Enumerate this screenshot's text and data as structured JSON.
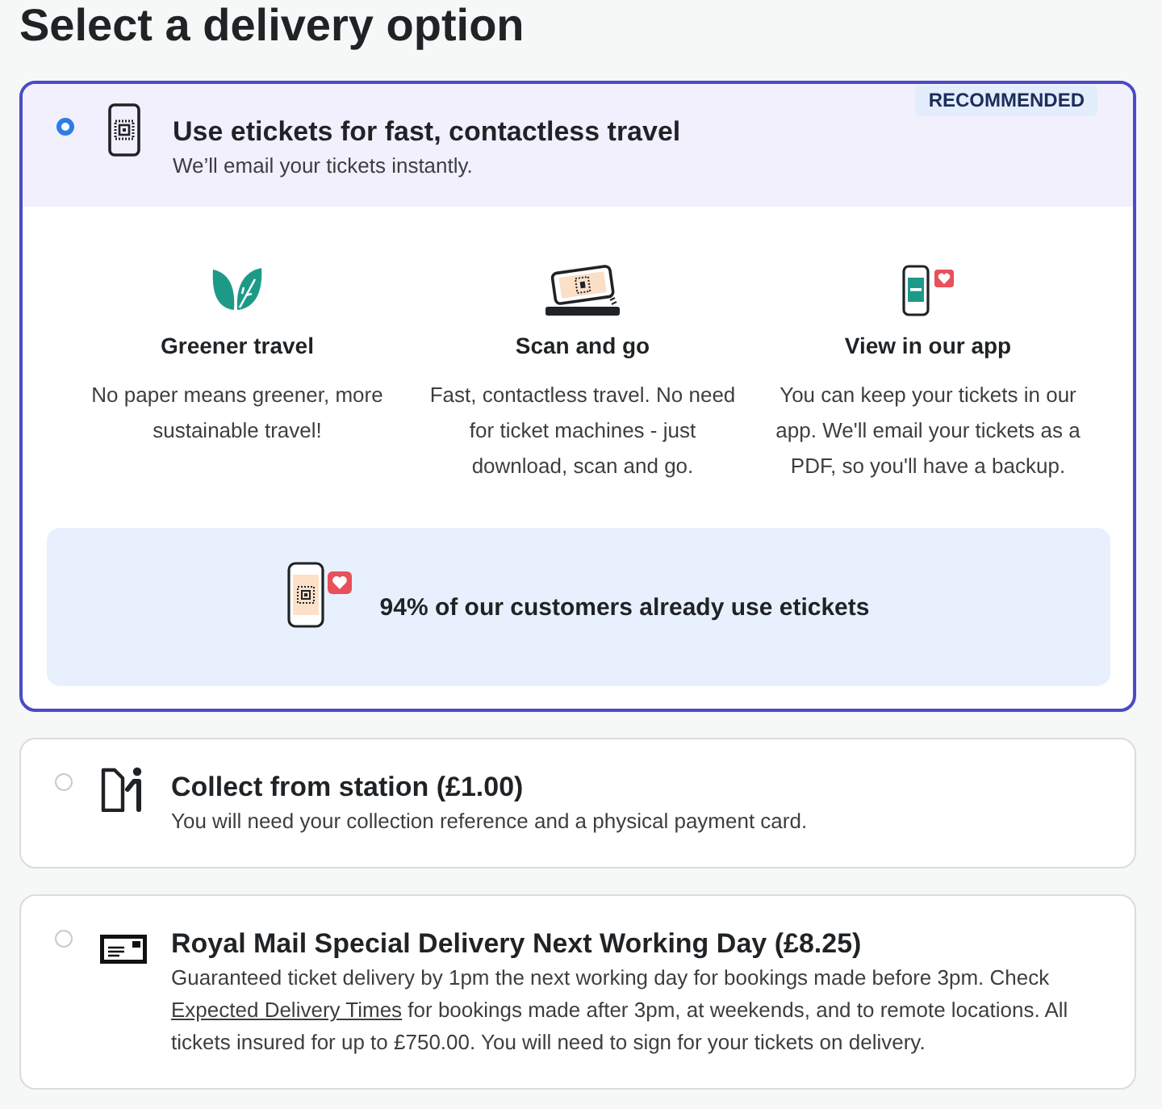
{
  "title": "Select a delivery option",
  "options": [
    {
      "kind": "eticket",
      "selected": true,
      "title": "Use etickets for fast, contactless travel",
      "description": [
        {
          "kind": "text",
          "text": "We’ll email your tickets instantly."
        }
      ],
      "badge": "RECOMMENDED",
      "features": [
        {
          "kind": "green",
          "heading": "Greener travel",
          "text": "No paper means greener, more sustainable travel!"
        },
        {
          "kind": "scan",
          "heading": "Scan and go",
          "text": "Fast, contactless travel. No need for ticket machines - just download, scan and go."
        },
        {
          "kind": "app",
          "heading": "View in our app",
          "text": "You can keep your tickets in our app. We'll email your tickets as a PDF, so you'll have a backup."
        }
      ],
      "stat": "94% of our customers already use etickets"
    },
    {
      "kind": "collect",
      "selected": false,
      "title": "Collect from station (£1.00)",
      "description": [
        {
          "kind": "text",
          "text": "You will need your collection reference and a physical payment card."
        }
      ]
    },
    {
      "kind": "post",
      "selected": false,
      "title": "Royal Mail Special Delivery Next Working Day (£8.25)",
      "description": [
        {
          "kind": "text",
          "text": "Guaranteed ticket delivery by 1pm the next working day for bookings made before 3pm. Check "
        },
        {
          "kind": "link",
          "text": "Expected Delivery Times"
        },
        {
          "kind": "text",
          "text": " for bookings made after 3pm, at weekends, and to remote locations. All tickets insured for up to £750.00. You will need to sign for your tickets on delivery."
        }
      ]
    }
  ]
}
